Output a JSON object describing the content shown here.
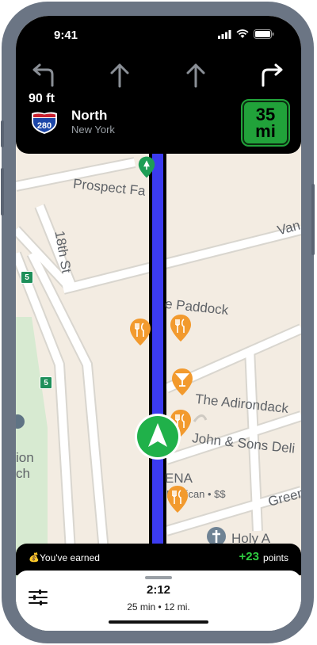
{
  "status": {
    "time": "9:41"
  },
  "lanes": [
    "turn-left-arrow",
    "straight-arrow",
    "straight-arrow",
    "turn-right-arrow"
  ],
  "instruction": {
    "distance": "90 ft",
    "shield_number": "280",
    "road": "North",
    "city": "New York"
  },
  "speed_limit": {
    "value": "35",
    "unit": "mi"
  },
  "map": {
    "labels": {
      "prospect": "Prospect Fa",
      "street18": "18th St",
      "paddock": "e Paddock",
      "adirondack": "The Adirondack",
      "johnsons": "John & Sons Deli",
      "ena": "ENA",
      "mexican": "Mexican • $$",
      "holy": "Holy A",
      "van": "Van",
      "green": "Green",
      "ion": "ion",
      "ch": "ch"
    },
    "route_color": "#3b3bf0",
    "hwy_shields": [
      "5",
      "5"
    ]
  },
  "earned": {
    "text": "You've earned",
    "points": "+23",
    "points_label": "points"
  },
  "trip": {
    "eta": "2:12",
    "summary": "25 min • 12 mi."
  }
}
